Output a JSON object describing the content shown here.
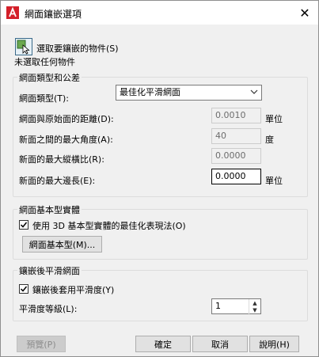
{
  "window": {
    "title": "網面鑲嵌選項",
    "close_glyph": "✕"
  },
  "selection": {
    "button_label": "選取要鑲嵌的物件(S)",
    "status": "未選取任何物件"
  },
  "mesh_type_group": {
    "title": "網面類型和公差",
    "mesh_type_label": "網面類型(T):",
    "mesh_type_value": "最佳化平滑網面",
    "distance_label": "網面與原始面的距離(D):",
    "distance_value": "0.0010",
    "distance_unit": "單位",
    "angle_label": "新面之間的最大角度(A):",
    "angle_value": "40",
    "angle_unit": "度",
    "aspect_label": "新面的最大縱橫比(R):",
    "aspect_value": "0.0000",
    "edge_label": "新面的最大邊長(E):",
    "edge_value": "0.0000",
    "edge_unit": "單位"
  },
  "primitive_group": {
    "title": "網面基本型實體",
    "use_optimized_label": "使用 3D 基本型實體的最佳化表現法(O)",
    "use_optimized_checked": true,
    "primitive_button": "網面基本型(M)..."
  },
  "smooth_group": {
    "title": "鑲嵌後平滑網面",
    "apply_smooth_label": "鑲嵌後套用平滑度(Y)",
    "apply_smooth_checked": true,
    "level_label": "平滑度等級(L):",
    "level_value": "1"
  },
  "buttons": {
    "preview": "預覽(P)",
    "ok": "確定",
    "cancel": "取消",
    "help": "說明(H)"
  },
  "colors": {
    "brand_red": "#d4202a",
    "accent": "#0078d7"
  }
}
